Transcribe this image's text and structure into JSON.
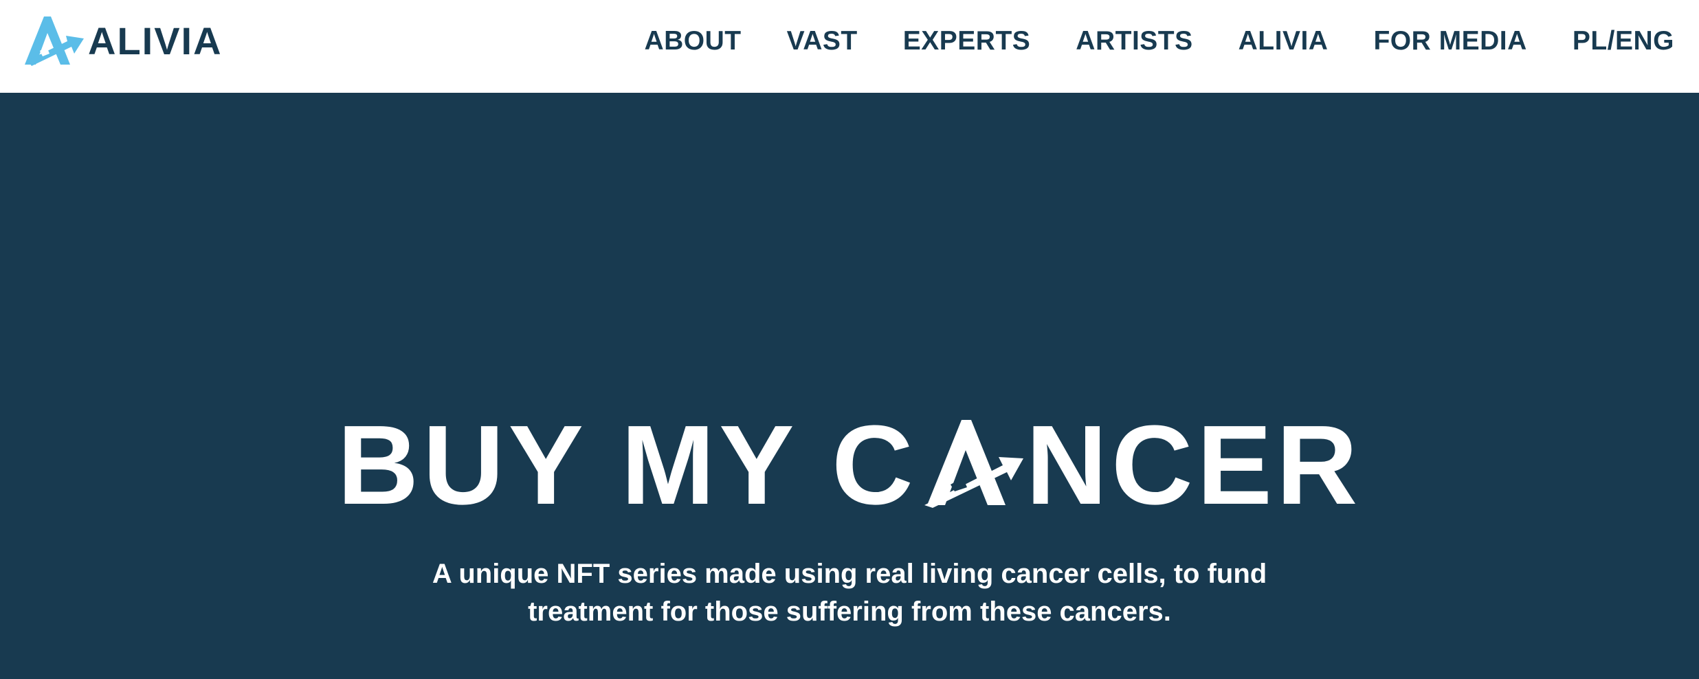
{
  "brand": {
    "name": "ALIVIA",
    "accent_color": "#5bbde8",
    "dark_color": "#183a50",
    "logo_icon": "arrow-a-logo-icon"
  },
  "nav": {
    "items": [
      {
        "label": "ABOUT"
      },
      {
        "label": "VAST"
      },
      {
        "label": "EXPERTS"
      },
      {
        "label": "ARTISTS"
      },
      {
        "label": "ALIVIA"
      },
      {
        "label": "FOR MEDIA"
      },
      {
        "label": "PL/ENG"
      }
    ]
  },
  "hero": {
    "title_before": "BUY MY C",
    "title_after": "NCER",
    "title_glyph_icon": "arrow-a-letter-icon",
    "subtitle": "A unique NFT series made using real living cancer cells, to fund treatment for those suffering from these cancers.",
    "background_color": "#183a50"
  }
}
